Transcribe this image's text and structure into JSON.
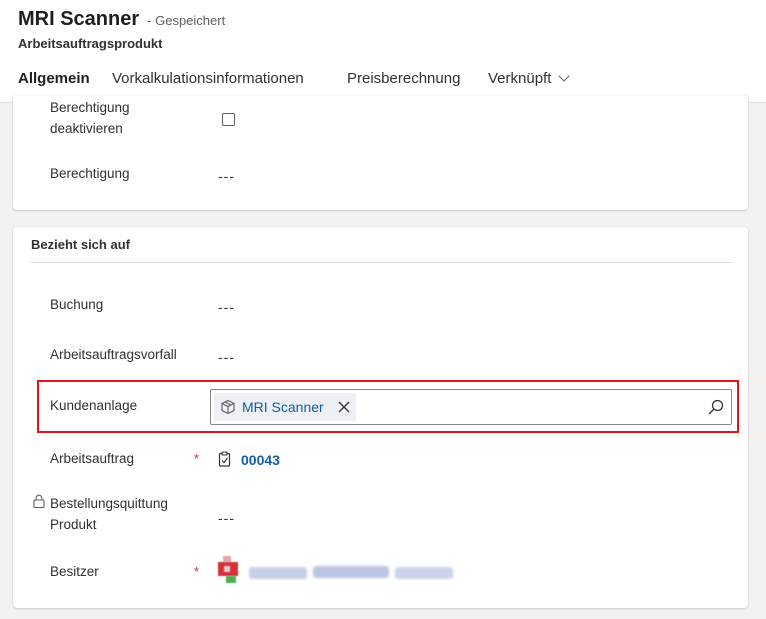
{
  "header": {
    "title": "MRI Scanner",
    "saved_status": "- Gespeichert",
    "subtitle": "Arbeitsauftragsprodukt"
  },
  "tabs": [
    {
      "label": "Allgemein",
      "active": true
    },
    {
      "label": "Vorkalkulationsinformationen"
    },
    {
      "label": "Preisberechnung"
    },
    {
      "label": "Verknüpft"
    }
  ],
  "general_section": {
    "berechtigung_deaktivieren_label_line1": "Berechtigung",
    "berechtigung_deaktivieren_label_line2": "deaktivieren",
    "berechtigung_deaktivieren_checked": false,
    "berechtigung_label": "Berechtigung",
    "berechtigung_value": "---"
  },
  "related_section": {
    "title": "Bezieht sich auf",
    "buchung_label": "Buchung",
    "buchung_value": "---",
    "vorfall_label": "Arbeitsauftragsvorfall",
    "vorfall_value": "---",
    "kundenanlage_label": "Kundenanlage",
    "kundenanlage_value": "MRI Scanner",
    "arbeitsauftrag_label": "Arbeitsauftrag",
    "arbeitsauftrag_required": "*",
    "arbeitsauftrag_value": "00043",
    "quittung_label_line1": "Bestellungsquittung",
    "quittung_label_line2": "Produkt",
    "quittung_value": "---",
    "besitzer_label": "Besitzer",
    "besitzer_required": "*"
  },
  "colors": {
    "accent": "#0f6cbd",
    "link": "#115ea3",
    "required": "#c4314b",
    "highlight_border": "#e3141f"
  },
  "icons": {
    "tag_icon": "product-box-icon",
    "remove_icon": "close-icon",
    "search_icon": "search-icon",
    "work_order_icon": "clipboard-icon",
    "lock_icon": "lock-icon",
    "owner_icon": "avatar"
  }
}
